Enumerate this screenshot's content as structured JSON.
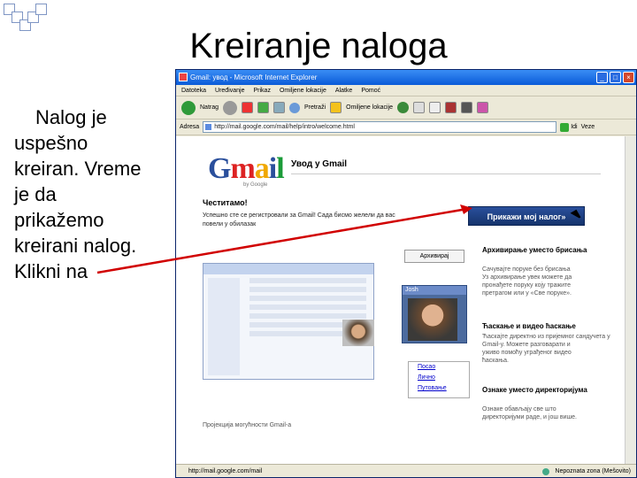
{
  "slide": {
    "title": "Kreiranje naloga",
    "body_lines": [
      "Nalog je",
      "uspešno",
      "kreiran. Vreme",
      "je da",
      "prikažemo",
      "kreirani nalog.",
      "Klikni na"
    ]
  },
  "browser": {
    "window_title": "Gmail: увод - Microsoft Internet Explorer",
    "menu": [
      "Datoteka",
      "Uređivanje",
      "Prikaz",
      "Omiljene lokacije",
      "Alatke",
      "Pomoć"
    ],
    "toolbar": {
      "back_label": "Natrag",
      "search_label": "Pretraži",
      "favorites_label": "Omiljene lokacije"
    },
    "address_label": "Adresa",
    "address_value": "http://mail.google.com/mail/help/intro/welcome.html",
    "go_label": "Idi",
    "links_label": "Veze",
    "status_left": "http://mail.google.com/mail",
    "status_right": "Nepoznata zona (Mešovito)"
  },
  "gmail_page": {
    "logo_text": "Gmail",
    "logo_subtext": "by Google",
    "header": "Увод у Gmail",
    "congrats": "Честитамо!",
    "intro_lines": [
      "Успешно сте се регистровали за Gmail! Сада бисмо желели да вас",
      "повели у обилазак"
    ],
    "primary_button": "Прикажи мој налог»",
    "archive_button": "Архивирај",
    "feature1_title": "Архивирање уместо брисања",
    "feature1_text": [
      "Сачувајте поруке без брисања",
      "Уз архивирање увек можете да",
      "пронађете поруку коју тражите",
      "претрагом или у «Све поруке»."
    ],
    "feature2_title": "Ћаскање и видео ћаскање",
    "feature2_text": [
      "Ћаскајте директно из пријемног сандучета у",
      "Gmail-у. Можете разговарати и",
      "уживо помоћу уграђеног видео",
      "ћаскања."
    ],
    "feature3_title": "Ознаке уместо директоријума",
    "feature3_text": [
      "Ознаке обављају све што",
      "директоријуми раде, и још више."
    ],
    "chat_name": "Josh",
    "labels_list": [
      "Посао",
      "Лично",
      "Путовање"
    ],
    "footer_note": "Пројекција могућности Gmail-а"
  },
  "colors": {
    "titlebar": "#0a5bd8",
    "primary_button": "#1f3f82",
    "arrow": "#d10000"
  }
}
